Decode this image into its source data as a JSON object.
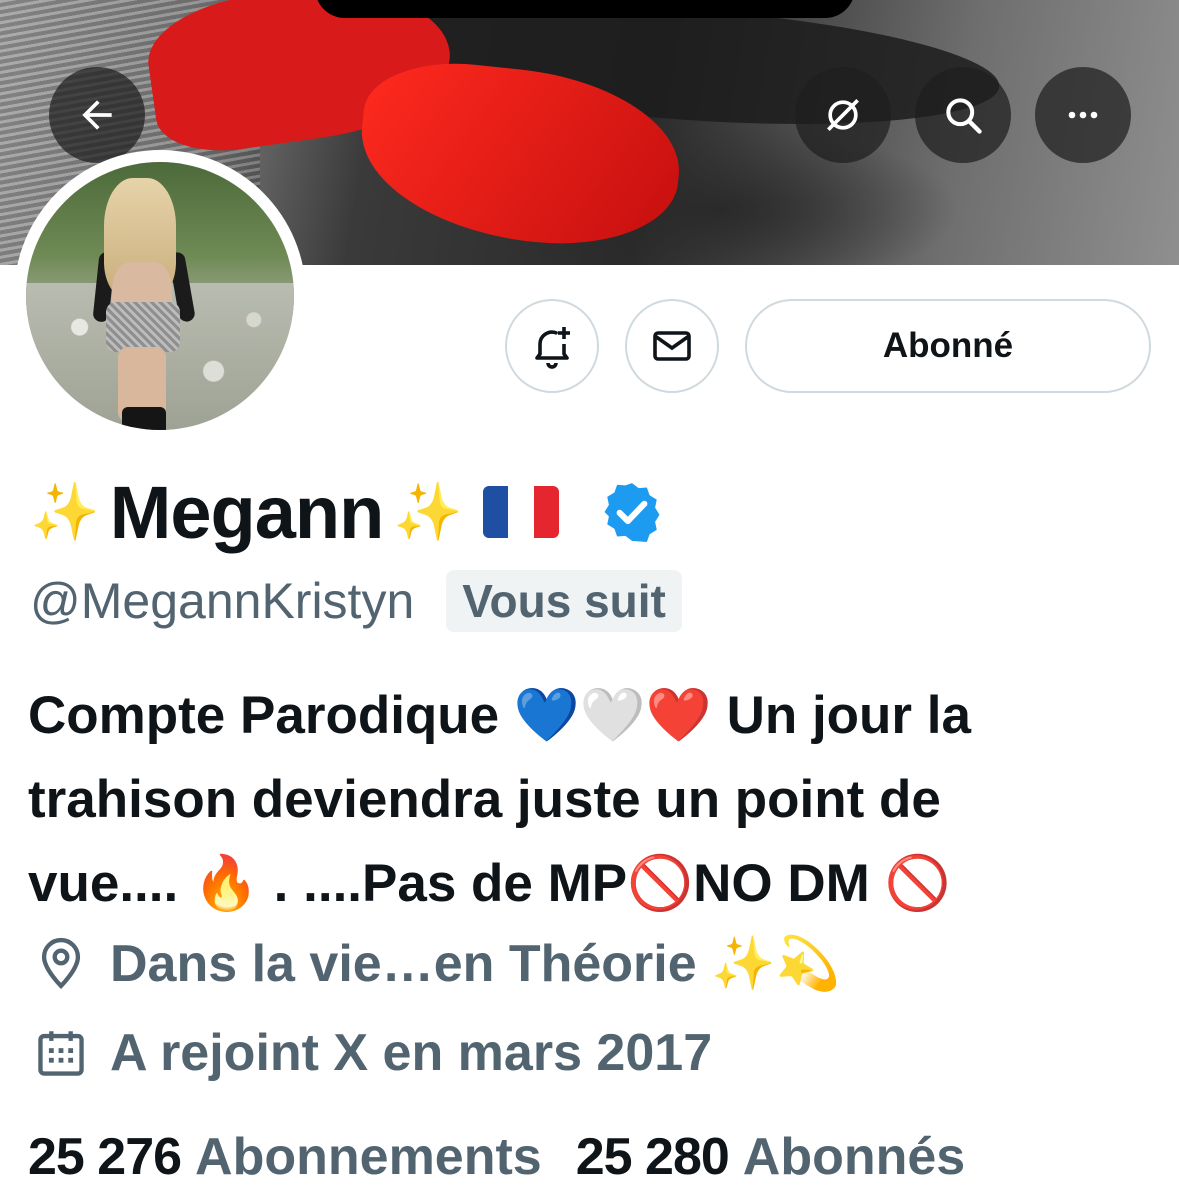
{
  "header": {
    "back_icon": "arrow-left-icon",
    "actions": [
      "translate-off-icon",
      "search-icon",
      "more-icon"
    ]
  },
  "profile_actions": {
    "notify_icon": "bell-plus-icon",
    "message_icon": "envelope-icon",
    "follow_label": "Abonné"
  },
  "profile": {
    "sparkle_left": "✨",
    "name": "Megann",
    "sparkle_right": "✨",
    "flag": "🇫🇷",
    "verified": true,
    "handle": "@MegannKristyn",
    "follows_you": "Vous suit",
    "bio_line1": "Compte Parodique 💙🤍❤️ Un jour la",
    "bio_line2": "trahison deviendra juste un point de",
    "bio_line3": "vue.... 🔥 . ....Pas de MP🚫NO DM 🚫",
    "location": "Dans la vie…en Théorie ✨💫",
    "joined": "A rejoint X en mars 2017"
  },
  "stats": {
    "following_count": "25 276",
    "following_label": "Abonnements",
    "followers_count": "25 280",
    "followers_label": "Abonnés"
  },
  "colors": {
    "text_primary": "#0f1419",
    "text_secondary": "#536471",
    "verified_blue": "#1d9bf0",
    "border": "#cfd9de"
  }
}
